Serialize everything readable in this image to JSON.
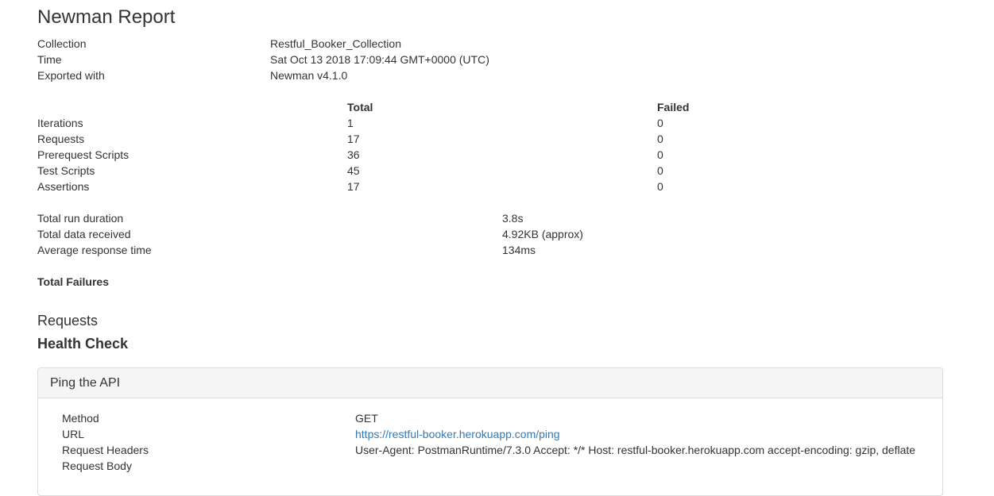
{
  "report": {
    "title": "Newman Report"
  },
  "meta": {
    "collection_label": "Collection",
    "collection_value": "Restful_Booker_Collection",
    "time_label": "Time",
    "time_value": "Sat Oct 13 2018 17:09:44 GMT+0000 (UTC)",
    "exported_label": "Exported with",
    "exported_value": "Newman v4.1.0"
  },
  "summary": {
    "header_total": "Total",
    "header_failed": "Failed",
    "rows": [
      {
        "label": "Iterations",
        "total": "1",
        "failed": "0"
      },
      {
        "label": "Requests",
        "total": "17",
        "failed": "0"
      },
      {
        "label": "Prerequest Scripts",
        "total": "36",
        "failed": "0"
      },
      {
        "label": "Test Scripts",
        "total": "45",
        "failed": "0"
      },
      {
        "label": "Assertions",
        "total": "17",
        "failed": "0"
      }
    ]
  },
  "stats": [
    {
      "label": "Total run duration",
      "value": "3.8s"
    },
    {
      "label": "Total data received",
      "value": "4.92KB (approx)"
    },
    {
      "label": "Average response time",
      "value": "134ms"
    }
  ],
  "failures": {
    "label": "Total Failures"
  },
  "requests": {
    "heading": "Requests",
    "folder": "Health Check",
    "item": {
      "title": "Ping the API",
      "method_label": "Method",
      "method_value": "GET",
      "url_label": "URL",
      "url_value": "https://restful-booker.herokuapp.com/ping",
      "headers_label": "Request Headers",
      "headers_value": "User-Agent: PostmanRuntime/7.3.0 Accept: */* Host: restful-booker.herokuapp.com accept-encoding: gzip, deflate",
      "body_label": "Request Body"
    }
  },
  "colors": {
    "link": "#337ab7",
    "panel_heading_bg": "#f5f5f5",
    "border": "#dddddd",
    "text": "#333333"
  }
}
